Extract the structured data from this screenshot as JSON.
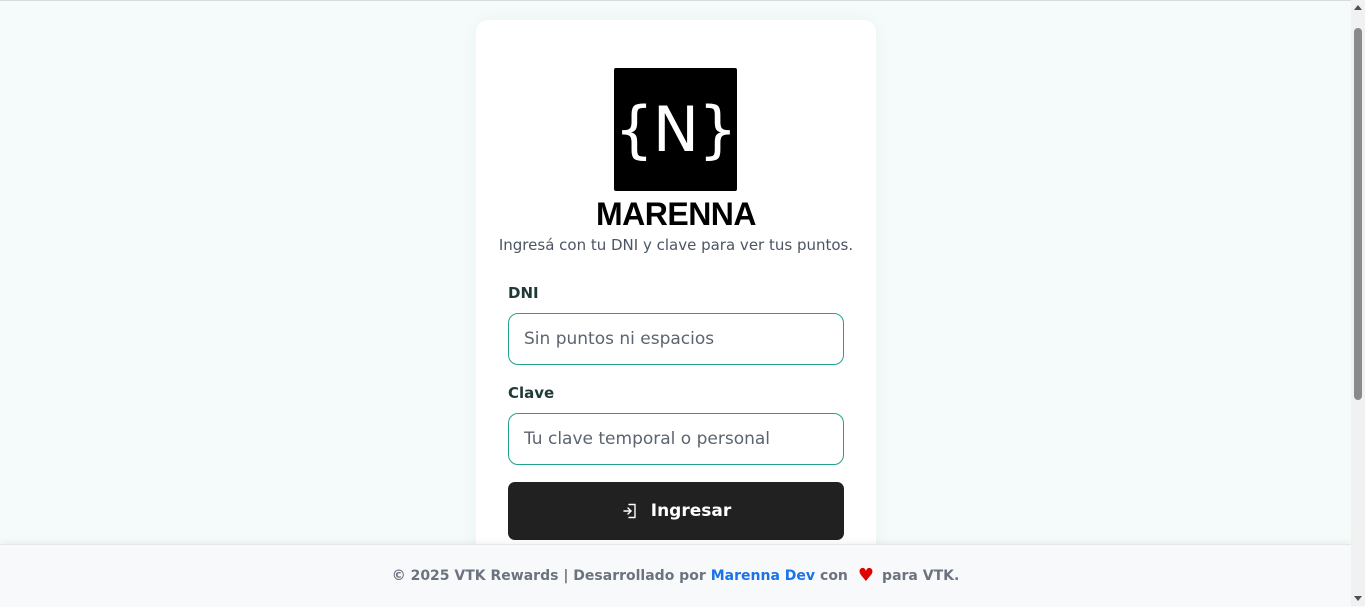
{
  "card": {
    "logo_text": "{N}",
    "brand": "MARENNA",
    "subtitle": "Ingresá con tu DNI y clave para ver tus puntos."
  },
  "form": {
    "dni_label": "DNI",
    "dni_placeholder": "Sin puntos ni espacios",
    "clave_label": "Clave",
    "clave_placeholder": "Tu clave temporal o personal",
    "submit_label": "Ingresar",
    "submit_icon": "login-icon"
  },
  "footer": {
    "prefix": "© 2025 VTK Rewards | Desarrollado por",
    "link": "Marenna Dev",
    "middle": "con",
    "heart_icon": "heart-icon",
    "suffix": "para VTK."
  },
  "colors": {
    "background": "#f4fbfa",
    "input_border": "#1fa38d",
    "button": "#212121",
    "link": "#1a73e8",
    "heart": "#e00000"
  }
}
